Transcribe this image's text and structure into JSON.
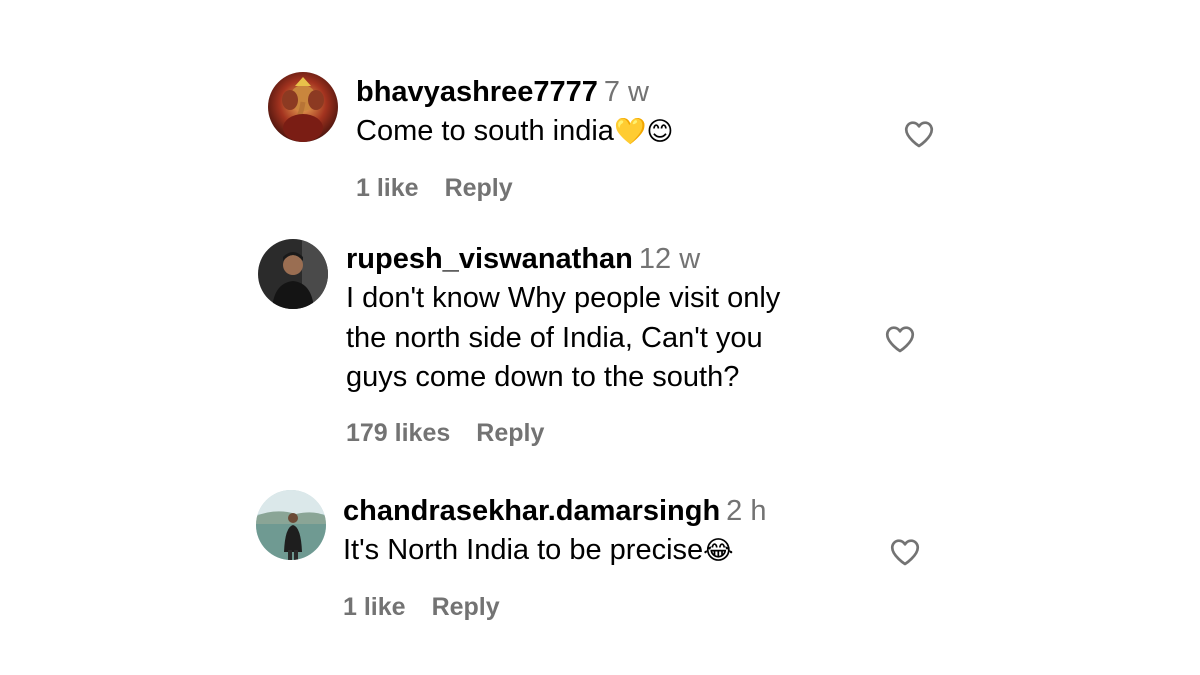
{
  "comments": [
    {
      "username": "bhavyashree7777",
      "time": "7 w",
      "lines": [
        "Come to south india"
      ],
      "emojis": [
        "💛",
        "😊"
      ],
      "likes": "1 like",
      "reply_label": "Reply",
      "avatar_icon": "ganesha-avatar"
    },
    {
      "username": "rupesh_viswanathan",
      "time": "12 w",
      "lines": [
        "I don't know Why people visit only",
        "the north side of India, Can't you",
        "guys come down to the south?"
      ],
      "likes": "179 likes",
      "reply_label": "Reply",
      "avatar_icon": "person-avatar"
    },
    {
      "username": "chandrasekhar.damarsingh",
      "time": "2 h",
      "lines": [
        "It's North India to be precise"
      ],
      "emojis": [
        "😂"
      ],
      "likes": "1 like",
      "reply_label": "Reply",
      "avatar_icon": "lake-person-avatar"
    }
  ],
  "colors": {
    "text": "#000000",
    "muted": "#737373",
    "heart_stroke": "#737373"
  },
  "icons": {
    "like": "heart-outline-icon"
  }
}
